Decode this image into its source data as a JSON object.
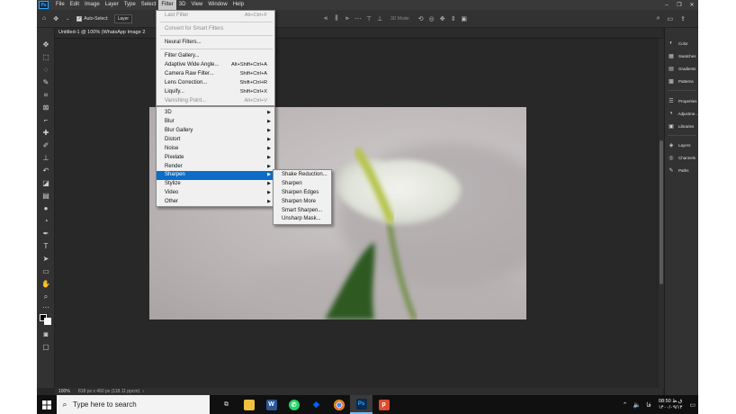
{
  "app": {
    "logo": "Ps"
  },
  "menubar": {
    "items": [
      "File",
      "Edit",
      "Image",
      "Layer",
      "Type",
      "Select",
      "Filter",
      "3D",
      "View",
      "Window",
      "Help"
    ],
    "active": "Filter"
  },
  "options": {
    "auto_select_label": "Auto-Select:",
    "auto_select_value": "Layer",
    "mode_3d": "3D Mode:"
  },
  "document": {
    "tab_title": "Untitled-1 @ 100% (WhatsApp Image 2"
  },
  "status": {
    "zoom": "100%",
    "doc_info": "818 px x 460 px (118.11 ppcm)"
  },
  "filter_menu": {
    "last_filter": "Last Filter",
    "last_filter_shortcut": "Alt+Ctrl+F",
    "convert_smart": "Convert for Smart Filters",
    "neural_filters": "Neural Filters...",
    "filter_gallery": "Filter Gallery...",
    "adaptive_wide_angle": "Adaptive Wide Angle...",
    "adaptive_wide_angle_shortcut": "Alt+Shift+Ctrl+A",
    "camera_raw": "Camera Raw Filter...",
    "camera_raw_shortcut": "Shift+Ctrl+A",
    "lens_correction": "Lens Correction...",
    "lens_correction_shortcut": "Shift+Ctrl+R",
    "liquify": "Liquify...",
    "liquify_shortcut": "Shift+Ctrl+X",
    "vanishing_point": "Vanishing Point...",
    "vanishing_point_shortcut": "Alt+Ctrl+V"
  },
  "filter_groups": [
    "3D",
    "Blur",
    "Blur Gallery",
    "Distort",
    "Noise",
    "Pixelate",
    "Render",
    "Sharpen",
    "Stylize",
    "Video",
    "Other"
  ],
  "sharpen_submenu": [
    "Shake Reduction...",
    "Sharpen",
    "Sharpen Edges",
    "Sharpen More",
    "Smart Sharpen...",
    "Unsharp Mask..."
  ],
  "panels": {
    "color": "Color",
    "swatches": "Swatches",
    "gradients": "Gradients",
    "patterns": "Patterns",
    "properties": "Properties",
    "adjustments": "Adjustme...",
    "libraries": "Libraries",
    "layers": "Layers",
    "channels": "Channels",
    "paths": "Paths"
  },
  "taskbar": {
    "search_placeholder": "Type here to search",
    "time": "08:50 ق.ظ",
    "date": "۱۴۰۰/۰۹/۱۳",
    "lang": "فا"
  }
}
